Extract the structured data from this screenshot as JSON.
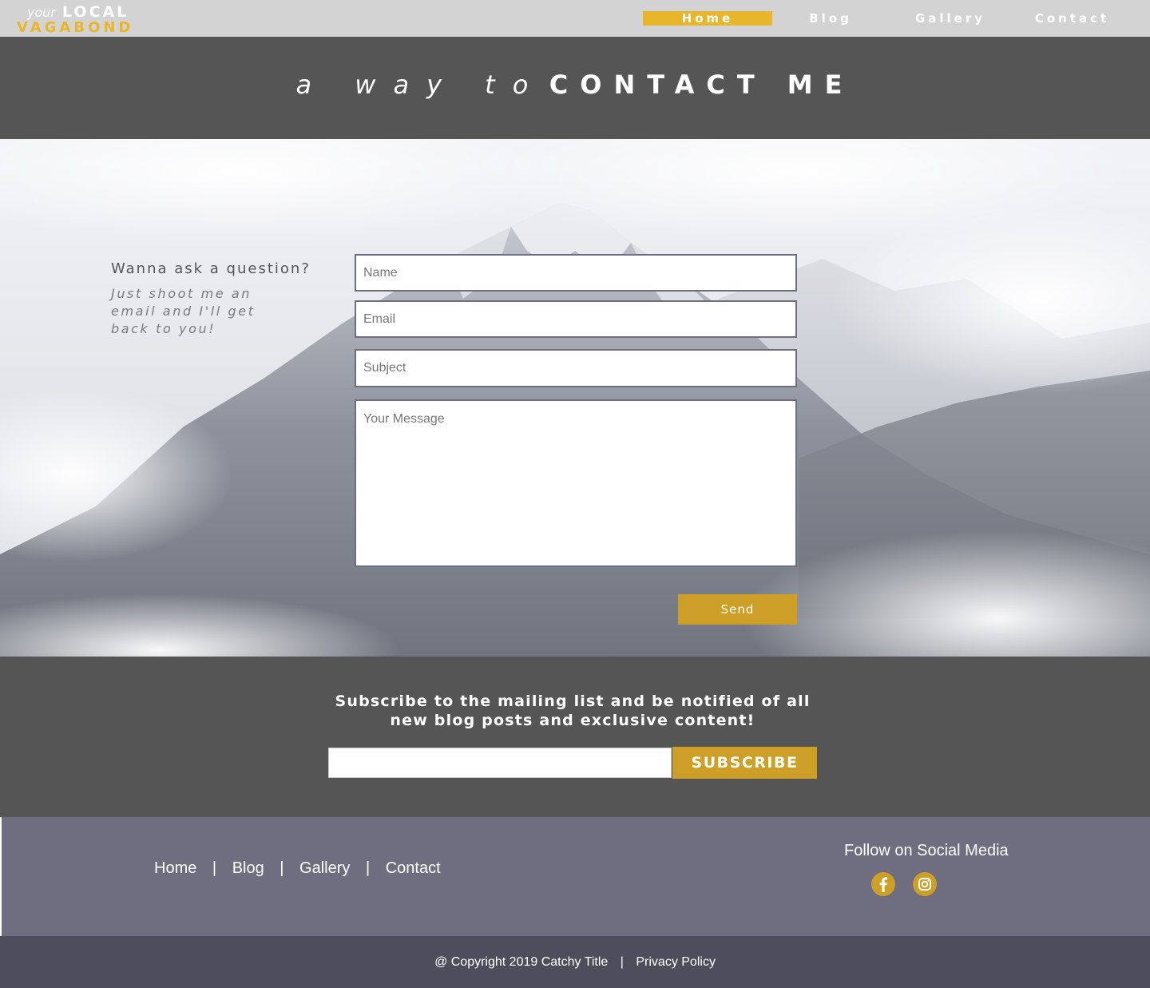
{
  "brand": {
    "your": "your",
    "local": "LOCAL",
    "vagabond": "VAGABOND",
    "accent_color": "#e8b62c"
  },
  "nav": {
    "items": [
      {
        "label": "Home",
        "active": true
      },
      {
        "label": "Blog"
      },
      {
        "label": "Gallery"
      },
      {
        "label": "Contact"
      }
    ]
  },
  "hero": {
    "lead": "a way to",
    "title": "CONTACT ME"
  },
  "contact": {
    "question": "Wanna ask a question?",
    "subtitle": "Just shoot me an email and I'll get back to you!",
    "name_placeholder": "Name",
    "email_placeholder": "Email",
    "subject_placeholder": "Subject",
    "message_placeholder": "Your Message",
    "send_label": "Send"
  },
  "subscribe": {
    "text": "Subscribe to the mailing list and be notified of all new blog posts and exclusive content!",
    "button_label": "SUBSCRIBE"
  },
  "footer": {
    "links": [
      "Home",
      "Blog",
      "Gallery",
      "Contact"
    ],
    "separator": "|",
    "follow_label": "Follow on Social Media",
    "social": [
      "facebook-icon",
      "instagram-icon"
    ]
  },
  "bottom": {
    "copyright": "@ Copyright 2019 Catchy Title",
    "separator": "|",
    "privacy": "Privacy Policy"
  },
  "colors": {
    "dark_band": "#555555",
    "footer": "#6e6e80",
    "bottom": "#4d4d5c",
    "gold": "#cd9f27"
  }
}
